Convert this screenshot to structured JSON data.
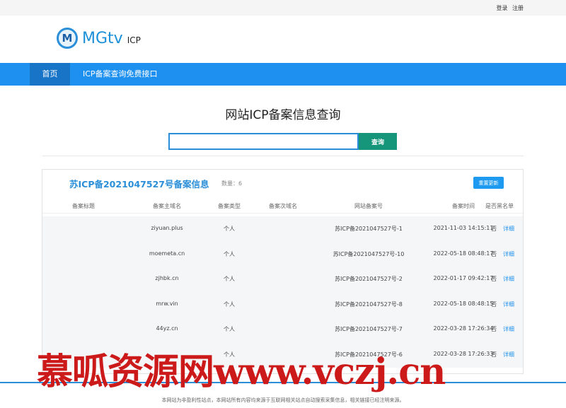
{
  "topbar": {
    "login": "登录",
    "register": "注册"
  },
  "logo": {
    "mark": "M",
    "name": "MGtv",
    "sub": "ICP"
  },
  "nav": {
    "home": "首页",
    "api": "ICP备案查询免费接口"
  },
  "page": {
    "title": "网站ICP备案信息查询"
  },
  "search": {
    "value": "",
    "button": "查询"
  },
  "panel": {
    "title": "苏ICP备2021047527号备案信息",
    "count": "数量：6",
    "refresh": "重置更新",
    "columns": [
      "备案标题",
      "备案主域名",
      "备案类型",
      "备案次域名",
      "网站备案号",
      "备案时间",
      "是否黑名单"
    ],
    "rows": [
      {
        "domain": "ziyuan.plus",
        "type": "个人",
        "icp": "苏ICP备2021047527号-1",
        "time": "2021-11-03 14:15:11",
        "black": "否",
        "action": "详细"
      },
      {
        "domain": "moemeta.cn",
        "type": "个人",
        "icp": "苏ICP备2021047527号-10",
        "time": "2022-05-18 08:48:17",
        "black": "否",
        "action": "详细"
      },
      {
        "domain": "zjhbk.cn",
        "type": "个人",
        "icp": "苏ICP备2021047527号-2",
        "time": "2022-01-17 09:42:17",
        "black": "否",
        "action": "详细"
      },
      {
        "domain": "mrw.vin",
        "type": "个人",
        "icp": "苏ICP备2021047527号-8",
        "time": "2022-05-18 08:48:15",
        "black": "否",
        "action": "详细"
      },
      {
        "domain": "44yz.cn",
        "type": "个人",
        "icp": "苏ICP备2021047527号-7",
        "time": "2022-03-28 17:26:34",
        "black": "否",
        "action": "详细"
      },
      {
        "domain": "",
        "type": "个人",
        "icp": "苏ICP备2021047527号-6",
        "time": "2022-03-28 17:26:33",
        "black": "否",
        "action": "详细"
      }
    ]
  },
  "watermark": "慕呱资源网www.vczj.cn",
  "footer": "本网站为非盈利性站点，本网站所有内容均来源于互联网相关站点自动搜索采集信息，相关链接已经注明来源。",
  "colors": {
    "accent": "#1e90ef",
    "search_button": "#15957a",
    "watermark": "#cc1a1a"
  }
}
